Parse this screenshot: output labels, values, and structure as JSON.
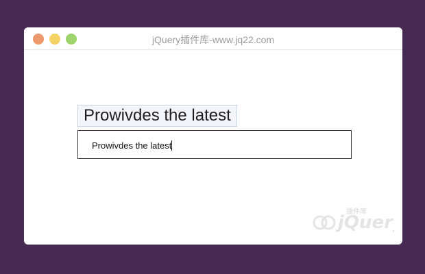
{
  "window": {
    "title": "jQuery插件库-www.jq22.com"
  },
  "demo": {
    "preview_text": "Prowivdes the latest",
    "input_value": "Prowivdes the latest"
  },
  "watermark": {
    "brand_text": "jQuery",
    "sub_text": "插件库"
  },
  "colors": {
    "background": "#472a52",
    "window": "#ffffff",
    "close_dot": "#ee9a6e",
    "minimize_dot": "#f6d365",
    "maximize_dot": "#9fd36b"
  }
}
